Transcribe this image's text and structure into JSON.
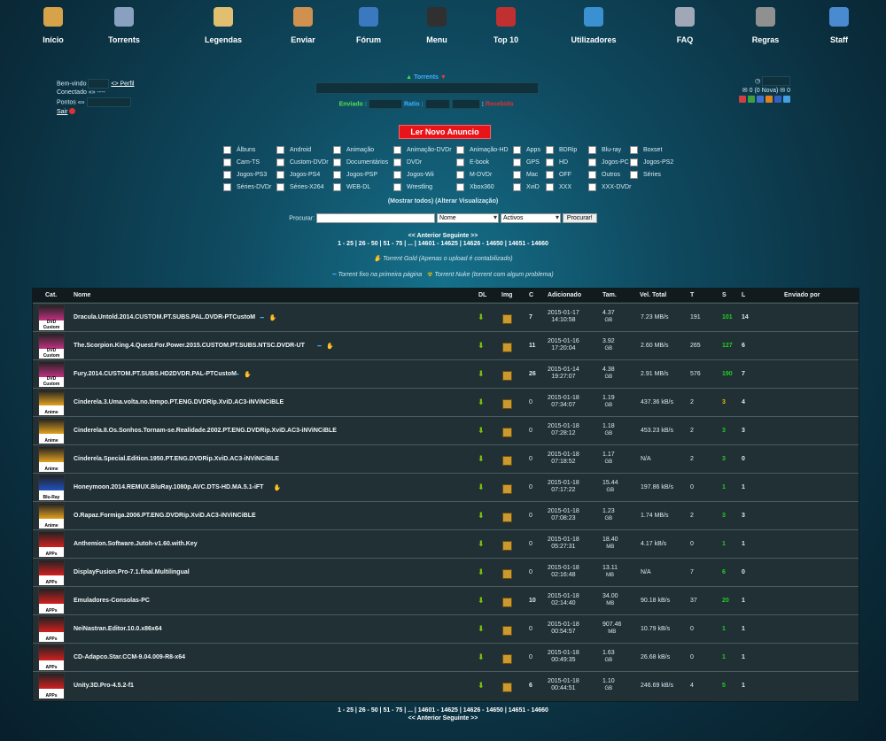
{
  "nav": [
    {
      "label": "Início",
      "icon": "home-icon",
      "color": "#d6a24a"
    },
    {
      "label": "Torrents",
      "icon": "torrents-icon",
      "color": "#8aa0c0"
    },
    {
      "label": "Legendas",
      "icon": "subtitles-icon",
      "color": "#e0c070"
    },
    {
      "label": "Enviar",
      "icon": "upload-icon",
      "color": "#d09050"
    },
    {
      "label": "Fórum",
      "icon": "forum-icon",
      "color": "#3a78c0"
    },
    {
      "label": "Menu",
      "icon": "menu-icon",
      "color": "#303030"
    },
    {
      "label": "Top 10",
      "icon": "top10-icon",
      "color": "#c03030"
    },
    {
      "label": "Utilizadores",
      "icon": "users-icon",
      "color": "#3a90d0"
    },
    {
      "label": "FAQ",
      "icon": "faq-icon",
      "color": "#a0a8b8"
    },
    {
      "label": "Regras",
      "icon": "rules-icon",
      "color": "#909090"
    },
    {
      "label": "Staff",
      "icon": "staff-icon",
      "color": "#4a8ad0"
    }
  ],
  "user": {
    "welcome": "Bem-vindo",
    "profile": "<> Perfil",
    "connected": "Conectado",
    "connected_val": "«» ----",
    "points": "Pontos",
    "points_val": "«»",
    "logout": "Sair"
  },
  "center": {
    "torrents": "Torrents",
    "sent": "Enviado :",
    "ratio": "Ratio :",
    "received": "Recebido"
  },
  "right": {
    "messages": "0 (0 Nova)",
    "other": "0"
  },
  "ad_button": "Ler Novo Anuncio",
  "categories": [
    [
      "Álbuns",
      "Android",
      "Animação",
      "Animação-DVDr",
      "Animação-HD",
      "Apps",
      "BDRip",
      "Blu-ray",
      "Boxset"
    ],
    [
      "Cam-TS",
      "Custom-DVDr",
      "Documentários",
      "DVDr",
      "E-book",
      "GPS",
      "HD",
      "Jogos-PC",
      "Jogos-PS2"
    ],
    [
      "Jogos-PS3",
      "Jogos-PS4",
      "Jogos-PSP",
      "Jogos-Wii",
      "M-DVDr",
      "Mac",
      "OFF",
      "Outros",
      "Séries"
    ],
    [
      "Séries-DVDr",
      "Séries-X264",
      "WEB-DL",
      "Wrestling",
      "Xbox360",
      "XviD",
      "XXX",
      "XXX-DVDr"
    ]
  ],
  "cat_links": "(Mostrar todos) (Alterar Visualização)",
  "search": {
    "label": "Procurar:",
    "field1": "Nome",
    "field2": "Activos",
    "button": "Procurar!"
  },
  "pager_top": {
    "nav": "<< Anterior      Seguinte >>",
    "pages": "1 - 25 | 26 - 50 | 51 - 75 | ... | 14601 - 14625 | 14626 - 14650 | 14651 - 14660"
  },
  "pager_bottom": {
    "pages": "1 - 25 | 26 - 50 | 51 - 75 | ... | 14601 - 14625 | 14626 - 14650 | 14651 - 14660",
    "nav": "<< Anterior      Seguinte >>"
  },
  "legend": {
    "gold": "Torrent Gold (Apenas o upload é contabilizado)",
    "pinned": "Torrent fixo na primeira página",
    "nuke": "Torrent Nuke (torrent com algum problema)"
  },
  "table": {
    "headers": {
      "cat": "Cat.",
      "name": "Nome",
      "dl": "DL",
      "img": "Img",
      "c": "C",
      "added": "Adicionado",
      "size": "Tam.",
      "speed": "Vel. Total",
      "t": "T",
      "s": "S",
      "l": "L",
      "by": "Enviado por"
    },
    "rows": [
      {
        "cat": "DVD Custom",
        "catcolor": "#c03080",
        "name": "Dracula.Untold.2014.CUSTOM.PT.SUBS.PAL.DVDR-PTCustoM",
        "c": "7",
        "date": "2015-01-17",
        "time": "14:10:58",
        "size": "4.37",
        "unit": "GB",
        "speed": "7.23 MB/s",
        "t": "191",
        "s": "101",
        "l": "14",
        "scolor": "green",
        "flags": "pin gold"
      },
      {
        "cat": "DVD Custom",
        "catcolor": "#c03080",
        "name": "The.Scorpion.King.4.Quest.For.Power.2015.CUSTOM.PT.SUBS.NTSC.DVDR-UT",
        "c": "11",
        "date": "2015-01-16",
        "time": "17:20:04",
        "size": "3.92",
        "unit": "GB",
        "speed": "2.60 MB/s",
        "t": "265",
        "s": "127",
        "l": "6",
        "scolor": "green",
        "flags": "pin gold"
      },
      {
        "cat": "DVD Custom",
        "catcolor": "#c03080",
        "name": "Fury.2014.CUSTOM.PT.SUBS.HD2DVDR.PAL-PTCustoM",
        "c": "26",
        "date": "2015-01-14",
        "time": "19:27:07",
        "size": "4.38",
        "unit": "GB",
        "speed": "2.91 MB/s",
        "t": "576",
        "s": "190",
        "l": "7",
        "scolor": "green",
        "flags": "pin gold"
      },
      {
        "cat": "Anime",
        "catcolor": "#e0a020",
        "name": "Cinderela.3.Uma.volta.no.tempo.PT.ENG.DVDRip.XviD.AC3-iNViNCiBLE",
        "c": "0",
        "date": "2015-01-18",
        "time": "07:34:07",
        "size": "1.19",
        "unit": "GB",
        "speed": "437.36 kB/s",
        "t": "2",
        "s": "3",
        "l": "4",
        "scolor": "yellow",
        "flags": ""
      },
      {
        "cat": "Anime",
        "catcolor": "#e0a020",
        "name": "Cinderela.II.Os.Sonhos.Tornam-se.Realidade.2002.PT.ENG.DVDRip.XviD.AC3-iNViNCiBLE",
        "c": "0",
        "date": "2015-01-18",
        "time": "07:28:12",
        "size": "1.18",
        "unit": "GB",
        "speed": "453.23 kB/s",
        "t": "2",
        "s": "3",
        "l": "3",
        "scolor": "green",
        "flags": ""
      },
      {
        "cat": "Anime",
        "catcolor": "#e0a020",
        "name": "Cinderela.Special.Edition.1950.PT.ENG.DVDRip.XviD.AC3-iNViNCiBLE",
        "c": "0",
        "date": "2015-01-18",
        "time": "07:18:52",
        "size": "1.17",
        "unit": "GB",
        "speed": "N/A",
        "t": "2",
        "s": "3",
        "l": "0",
        "scolor": "green",
        "flags": ""
      },
      {
        "cat": "Blu-Ray",
        "catcolor": "#2050c0",
        "name": "Honeymoon.2014.REMUX.BluRay.1080p.AVC.DTS-HD.MA.5.1-iFT",
        "c": "0",
        "date": "2015-01-18",
        "time": "07:17:22",
        "size": "15.44",
        "unit": "GB",
        "speed": "197.86 kB/s",
        "t": "0",
        "s": "1",
        "l": "1",
        "scolor": "green",
        "flags": "gold"
      },
      {
        "cat": "Anime",
        "catcolor": "#e0a020",
        "name": "O.Rapaz.Formiga.2006.PT.ENG.DVDRip.XviD.AC3-iNViNCiBLE",
        "c": "0",
        "date": "2015-01-18",
        "time": "07:08:23",
        "size": "1.23",
        "unit": "GB",
        "speed": "1.74 MB/s",
        "t": "2",
        "s": "3",
        "l": "3",
        "scolor": "green",
        "flags": ""
      },
      {
        "cat": "APPs",
        "catcolor": "#d02020",
        "name": "Anthemion.Software.Jutoh-v1.60.with.Key",
        "c": "0",
        "date": "2015-01-18",
        "time": "05:27:31",
        "size": "18.40",
        "unit": "MB",
        "speed": "4.17 kB/s",
        "t": "0",
        "s": "1",
        "l": "1",
        "scolor": "green",
        "flags": ""
      },
      {
        "cat": "APPs",
        "catcolor": "#d02020",
        "name": "DisplayFusion.Pro-7.1.final.Multilingual",
        "c": "0",
        "date": "2015-01-18",
        "time": "02:16:48",
        "size": "13.11",
        "unit": "MB",
        "speed": "N/A",
        "t": "7",
        "s": "6",
        "l": "0",
        "scolor": "green",
        "flags": ""
      },
      {
        "cat": "APPs",
        "catcolor": "#d02020",
        "name": "Emuladores-Consolas-PC",
        "c": "10",
        "date": "2015-01-18",
        "time": "02:14:40",
        "size": "34.00",
        "unit": "MB",
        "speed": "90.18 kB/s",
        "t": "37",
        "s": "20",
        "l": "1",
        "scolor": "green",
        "flags": ""
      },
      {
        "cat": "APPs",
        "catcolor": "#d02020",
        "name": "NeiNastran.Editor.10.0.x86x64",
        "c": "0",
        "date": "2015-01-18",
        "time": "00:54:57",
        "size": "907.46",
        "unit": "MB",
        "speed": "10.79 kB/s",
        "t": "0",
        "s": "1",
        "l": "1",
        "scolor": "green",
        "flags": ""
      },
      {
        "cat": "APPs",
        "catcolor": "#d02020",
        "name": "CD-Adapco.Star.CCM-9.04.009-R8-x64",
        "c": "0",
        "date": "2015-01-18",
        "time": "00:49:35",
        "size": "1.63",
        "unit": "GB",
        "speed": "26.68 kB/s",
        "t": "0",
        "s": "1",
        "l": "1",
        "scolor": "green",
        "flags": ""
      },
      {
        "cat": "APPs",
        "catcolor": "#d02020",
        "name": "Unity.3D.Pro-4.5.2-f1",
        "c": "6",
        "date": "2015-01-18",
        "time": "00:44:51",
        "size": "1.10",
        "unit": "GB",
        "speed": "246.69 kB/s",
        "t": "4",
        "s": "5",
        "l": "1",
        "scolor": "green",
        "flags": ""
      }
    ]
  }
}
